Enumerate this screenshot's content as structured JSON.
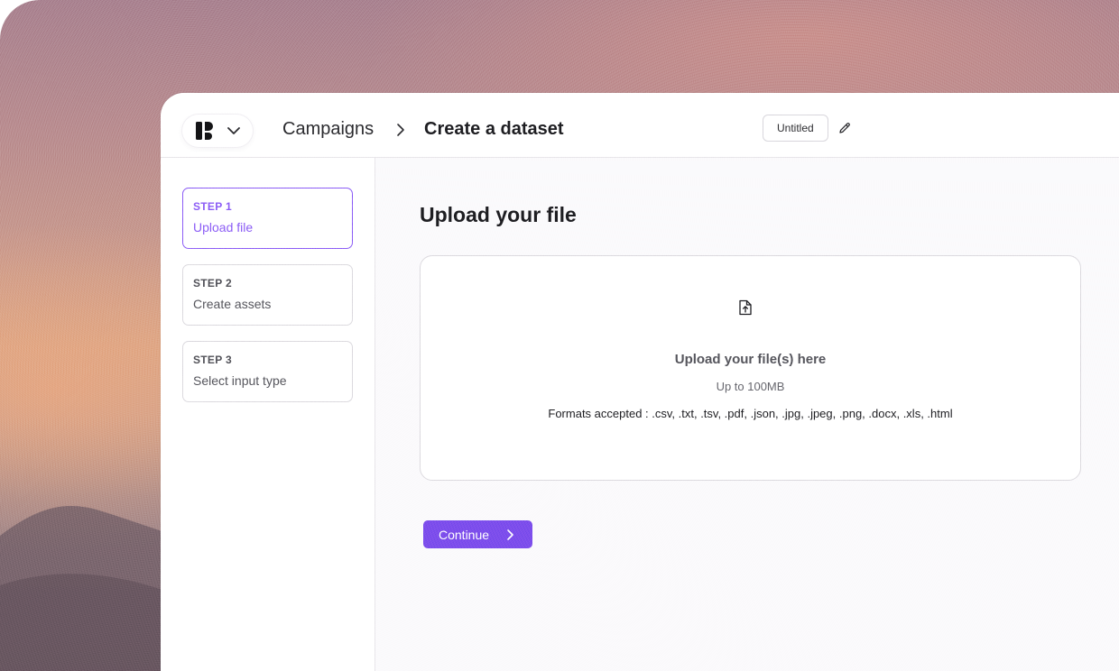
{
  "header": {
    "breadcrumb_root": "Campaigns",
    "breadcrumb_current": "Create a dataset",
    "dataset_title": "Untitled",
    "icons": {
      "logo": "workspace-logo-icon",
      "switcher": "chevron-down-icon",
      "separator": "chevron-right-icon",
      "edit": "pencil-icon"
    }
  },
  "steps": [
    {
      "number": "STEP 1",
      "label": "Upload file",
      "active": true
    },
    {
      "number": "STEP 2",
      "label": "Create assets",
      "active": false
    },
    {
      "number": "STEP 3",
      "label": "Select input type",
      "active": false
    }
  ],
  "main": {
    "title": "Upload your file",
    "dropzone": {
      "icon": "file-upload-icon",
      "title": "Upload your file(s) here",
      "limit": "Up to 100MB",
      "formats": "Formats accepted : .csv, .txt, .tsv, .pdf, .json, .jpg, .jpeg, .png, .docx, .xls, .html"
    },
    "continue_label": "Continue",
    "continue_icon": "chevron-right-icon"
  },
  "colors": {
    "accent": "#8b5cf6",
    "button": "#7c4dec",
    "text_dark": "#1d1d21",
    "border": "#dcdadf"
  }
}
